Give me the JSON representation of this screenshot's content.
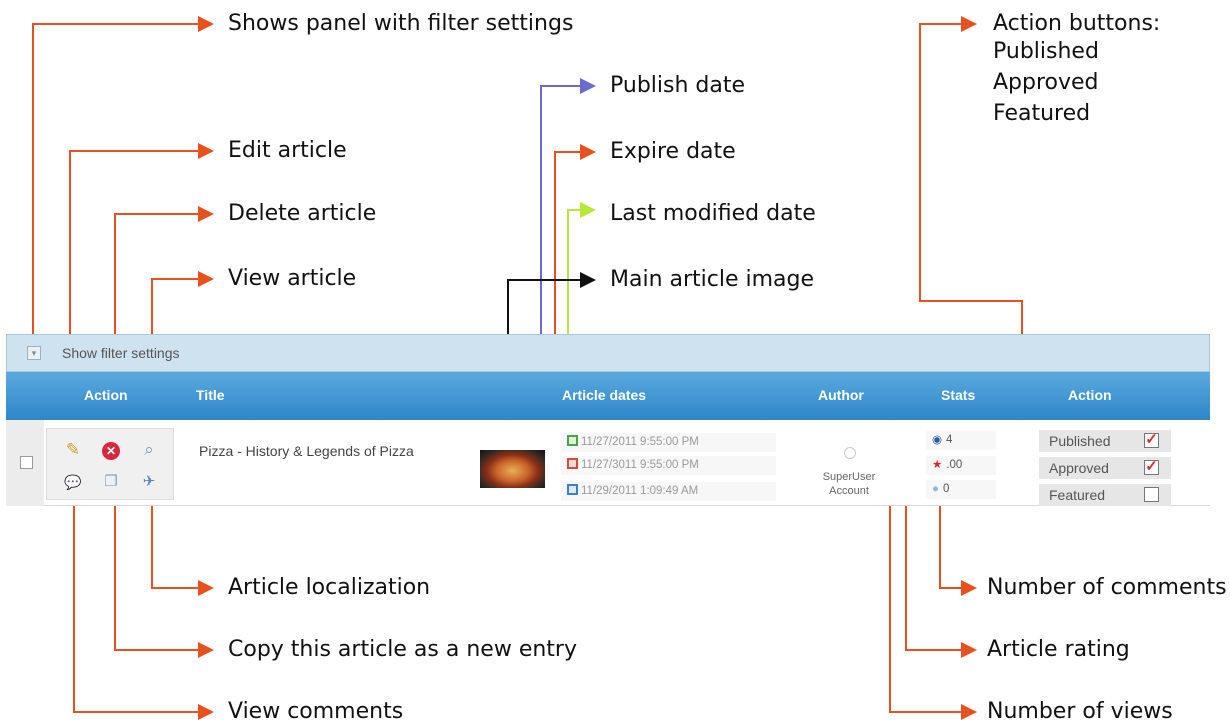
{
  "callouts": {
    "filter": "Shows panel with filter settings",
    "edit": "Edit article",
    "delete": "Delete article",
    "view": "View article",
    "publish_date": "Publish date",
    "expire_date": "Expire date",
    "modified_date": "Last modified date",
    "main_image": "Main article image",
    "action_buttons": [
      "Action buttons:",
      "Published",
      "Approved",
      "Featured"
    ],
    "localization": "Article localization",
    "copy": "Copy this article as a new entry",
    "comments_view": "View comments",
    "num_comments": "Number of comments",
    "rating": "Article rating",
    "views": "Number of views"
  },
  "filter_bar": {
    "label": "Show filter settings"
  },
  "table": {
    "headers": [
      "Action",
      "Title",
      "Article dates",
      "Author",
      "Stats",
      "Action"
    ],
    "row": {
      "title": "Pizza - History & Legends of Pizza",
      "dates": [
        "11/27/2011 9:55:00 PM",
        "11/27/3011 9:55:00 PM",
        "11/29/2011 1:09:49 AM"
      ],
      "author": "SuperUser Account",
      "stats": {
        "views": "4",
        "rating": ".00",
        "comments": "0"
      },
      "toggles": [
        {
          "label": "Published",
          "checked": true
        },
        {
          "label": "Approved",
          "checked": true
        },
        {
          "label": "Featured",
          "checked": false
        }
      ]
    }
  },
  "colors": {
    "leader": "#e8501e",
    "publish": "#6a6ad0",
    "modified": "#b8e83c",
    "image": "#111111",
    "header": "#3a93d2"
  },
  "icons": [
    "pencil-icon",
    "delete-icon",
    "view-icon",
    "comments-icon",
    "copy-icon",
    "localization-icon",
    "calendar-icon",
    "eye-icon",
    "star-icon",
    "comment-icon",
    "checkbox-icon"
  ]
}
